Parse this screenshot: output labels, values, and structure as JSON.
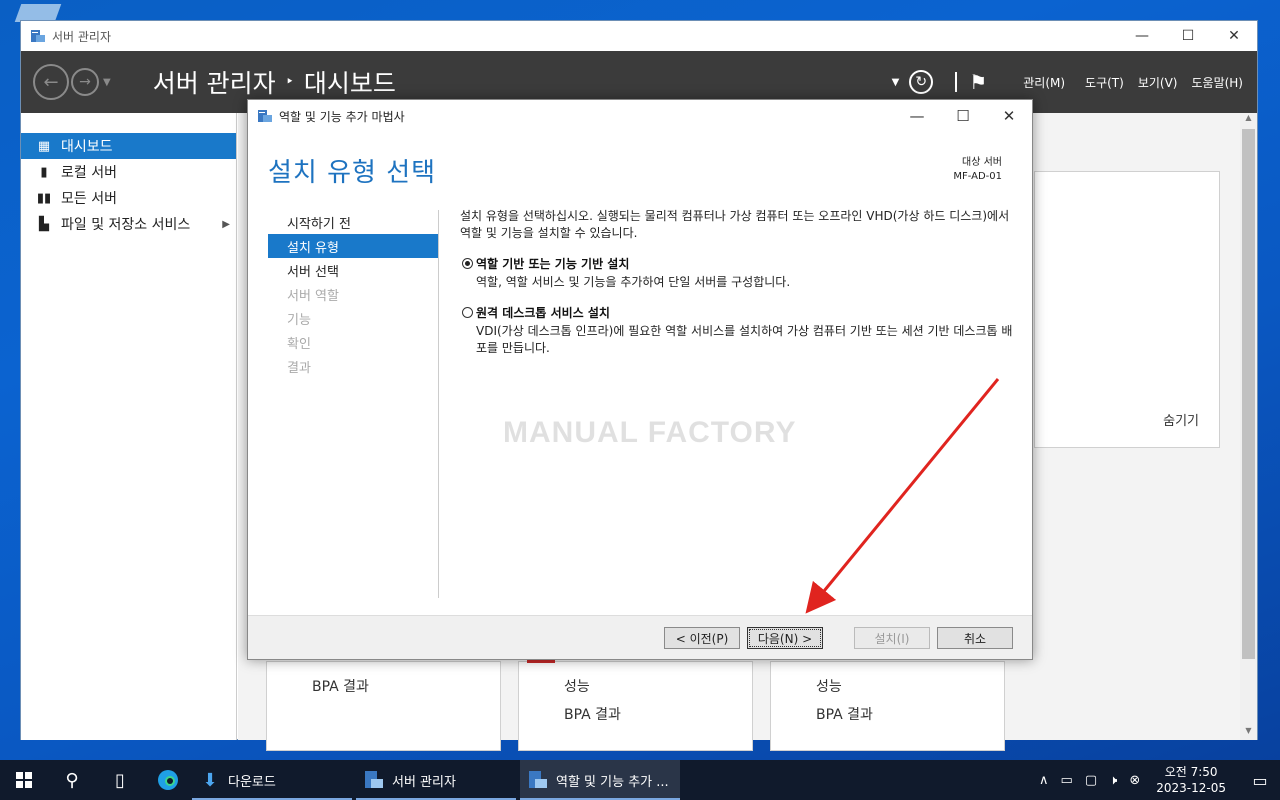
{
  "server_manager": {
    "window_title": "서버 관리자",
    "breadcrumb_root": "서버 관리자",
    "breadcrumb_sep": "‣",
    "breadcrumb_current": "대시보드",
    "menu": {
      "manage": "관리(M)",
      "tools": "도구(T)",
      "view": "보기(V)",
      "help": "도움말(H)"
    },
    "sidebar": [
      {
        "label": "대시보드",
        "icon": "dashboard-icon",
        "active": true
      },
      {
        "label": "로컬 서버",
        "icon": "local-server-icon",
        "active": false
      },
      {
        "label": "모든 서버",
        "icon": "all-servers-icon",
        "active": false
      },
      {
        "label": "파일 및 저장소 서비스",
        "icon": "file-storage-icon",
        "active": false,
        "has_submenu": true
      }
    ],
    "welcome_hide": "숨기기",
    "tiles": [
      {
        "rows": [
          "BPA 결과"
        ]
      },
      {
        "rows": [
          "성능",
          "BPA 결과"
        ]
      },
      {
        "rows": [
          "성능",
          "BPA 결과"
        ]
      }
    ]
  },
  "wizard": {
    "window_title": "역할 및 기능 추가 마법사",
    "heading": "설치 유형 선택",
    "target_label": "대상 서버",
    "target_server": "MF-AD-01",
    "steps": [
      {
        "label": "시작하기 전",
        "state": "normal"
      },
      {
        "label": "설치 유형",
        "state": "active"
      },
      {
        "label": "서버 선택",
        "state": "normal"
      },
      {
        "label": "서버 역할",
        "state": "disabled"
      },
      {
        "label": "기능",
        "state": "disabled"
      },
      {
        "label": "확인",
        "state": "disabled"
      },
      {
        "label": "결과",
        "state": "disabled"
      }
    ],
    "description": "설치 유형을 선택하십시오. 실행되는 물리적 컴퓨터나 가상 컴퓨터 또는 오프라인 VHD(가상 하드 디스크)에서 역할 및 기능을 설치할 수 있습니다.",
    "options": [
      {
        "title": "역할 기반 또는 기능 기반 설치",
        "desc": "역할, 역할 서비스 및 기능을 추가하여 단일 서버를 구성합니다.",
        "selected": true
      },
      {
        "title": "원격 데스크톱 서비스 설치",
        "desc": "VDI(가상 데스크톱 인프라)에 필요한 역할 서비스를 설치하여 가상 컴퓨터 기반 또는 세션 기반 데스크톱 배포를 만듭니다.",
        "selected": false
      }
    ],
    "watermark": "MANUAL FACTORY",
    "buttons": {
      "prev": "< 이전(P)",
      "next": "다음(N) >",
      "install": "설치(I)",
      "cancel": "취소"
    }
  },
  "taskbar": {
    "apps": [
      {
        "label": "다운로드",
        "icon": "download-folder-icon",
        "active": false
      },
      {
        "label": "서버 관리자",
        "icon": "server-manager-icon",
        "active": false
      },
      {
        "label": "역할 및 기능 추가 ...",
        "icon": "wizard-icon",
        "active": true
      }
    ],
    "time": "오전 7:50",
    "date": "2023-12-05"
  },
  "colors": {
    "accent": "#1979ca",
    "header_bg": "#3b3b3b",
    "arrow": "#e0241f",
    "taskbar": "#101a2c"
  }
}
